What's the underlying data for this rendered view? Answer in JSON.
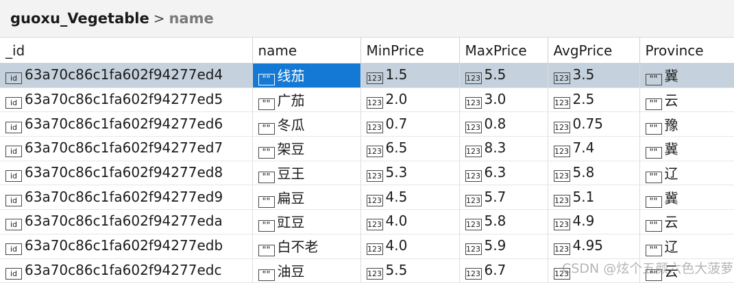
{
  "breadcrumb": {
    "collection": "guoxu_Vegetable",
    "separator": ">",
    "field": "name"
  },
  "type_icons": {
    "id": "id",
    "string": "\"\"",
    "number": "123"
  },
  "columns": [
    "_id",
    "name",
    "MinPrice",
    "MaxPrice",
    "AvgPrice",
    "Province"
  ],
  "rows": [
    [
      "63a70c86c1fa602f94277ed4",
      "线茄",
      "1.5",
      "5.5",
      "3.5",
      "冀"
    ],
    [
      "63a70c86c1fa602f94277ed5",
      "广茄",
      "2.0",
      "3.0",
      "2.5",
      "云"
    ],
    [
      "63a70c86c1fa602f94277ed6",
      "冬瓜",
      "0.7",
      "0.8",
      "0.75",
      "豫"
    ],
    [
      "63a70c86c1fa602f94277ed7",
      "架豆",
      "6.5",
      "8.3",
      "7.4",
      "冀"
    ],
    [
      "63a70c86c1fa602f94277ed8",
      "豆王",
      "5.3",
      "6.3",
      "5.8",
      "辽"
    ],
    [
      "63a70c86c1fa602f94277ed9",
      "扁豆",
      "4.5",
      "5.7",
      "5.1",
      "冀"
    ],
    [
      "63a70c86c1fa602f94277eda",
      "豇豆",
      "4.0",
      "5.8",
      "4.9",
      "云"
    ],
    [
      "63a70c86c1fa602f94277edb",
      "白不老",
      "4.0",
      "5.9",
      "4.95",
      "辽"
    ],
    [
      "63a70c86c1fa602f94277edc",
      "油豆",
      "5.5",
      "6.7",
      "",
      "云"
    ]
  ],
  "watermark": "CSDN @炫个五颜六色大菠萝"
}
